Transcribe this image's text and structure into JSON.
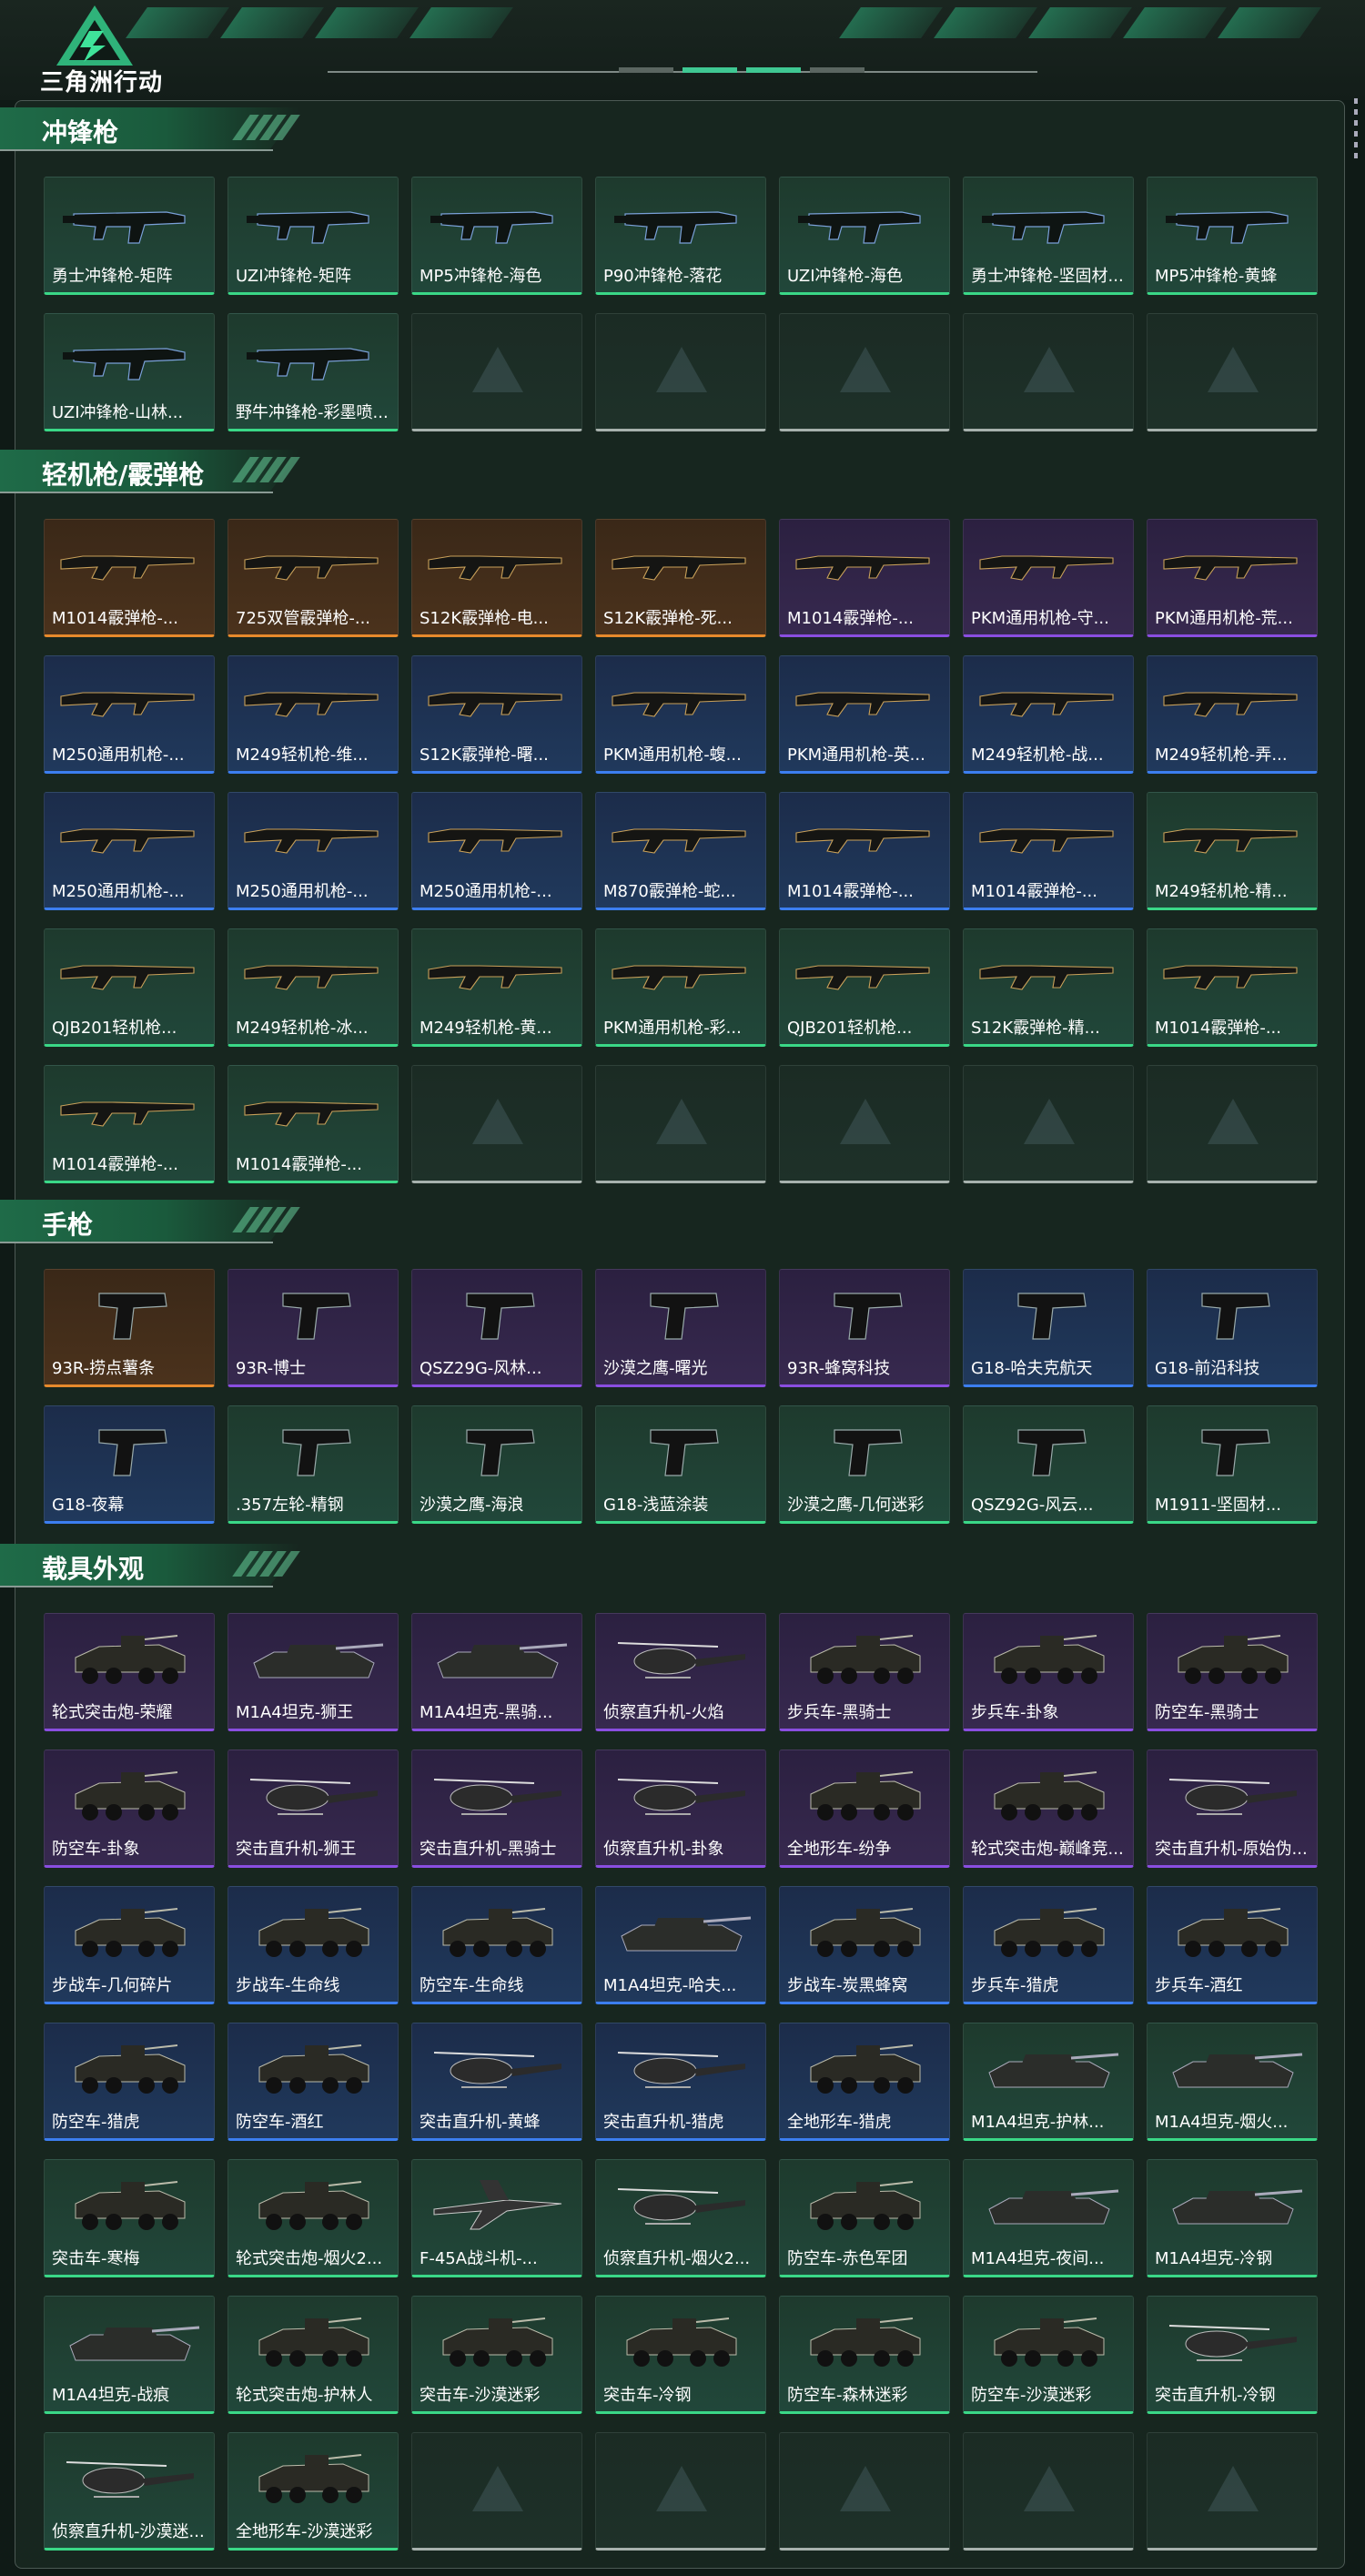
{
  "brand": "三角洲行动",
  "colors": {
    "accent": "#3fc893",
    "q_green": "#3ad887",
    "q_blue": "#3c7ef0",
    "q_purple": "#8a4ee0",
    "q_orange": "#e78a2c"
  },
  "sections": [
    {
      "title": "冲锋枪",
      "items": [
        {
          "name": "勇士冲锋枪-矩阵",
          "q": "green",
          "t": "smg"
        },
        {
          "name": "UZI冲锋枪-矩阵",
          "q": "green",
          "t": "smg"
        },
        {
          "name": "MP5冲锋枪-海色",
          "q": "green",
          "t": "smg"
        },
        {
          "name": "P90冲锋枪-落花",
          "q": "green",
          "t": "smg"
        },
        {
          "name": "UZI冲锋枪-海色",
          "q": "green",
          "t": "smg"
        },
        {
          "name": "勇士冲锋枪-坚固材...",
          "q": "green",
          "t": "smg"
        },
        {
          "name": "MP5冲锋枪-黄蜂",
          "q": "green",
          "t": "smg"
        },
        {
          "name": "UZI冲锋枪-山林...",
          "q": "green",
          "t": "smg"
        },
        {
          "name": "野牛冲锋枪-彩墨喷...",
          "q": "green",
          "t": "smg"
        },
        {
          "name": "",
          "q": "empty"
        },
        {
          "name": "",
          "q": "empty"
        },
        {
          "name": "",
          "q": "empty"
        },
        {
          "name": "",
          "q": "empty"
        },
        {
          "name": "",
          "q": "empty"
        }
      ]
    },
    {
      "title": "轻机枪/霰弹枪",
      "items": [
        {
          "name": "M1014霰弹枪-...",
          "q": "orange",
          "t": "rifle"
        },
        {
          "name": "725双管霰弹枪-...",
          "q": "orange",
          "t": "rifle"
        },
        {
          "name": "S12K霰弹枪-电...",
          "q": "orange",
          "t": "rifle"
        },
        {
          "name": "S12K霰弹枪-死...",
          "q": "orange",
          "t": "rifle"
        },
        {
          "name": "M1014霰弹枪-...",
          "q": "purple",
          "t": "rifle"
        },
        {
          "name": "PKM通用机枪-守...",
          "q": "purple",
          "t": "rifle"
        },
        {
          "name": "PKM通用机枪-荒...",
          "q": "purple",
          "t": "rifle"
        },
        {
          "name": "M250通用机枪-...",
          "q": "blue",
          "t": "rifle"
        },
        {
          "name": "M249轻机枪-维...",
          "q": "blue",
          "t": "rifle"
        },
        {
          "name": "S12K霰弹枪-曙...",
          "q": "blue",
          "t": "rifle"
        },
        {
          "name": "PKM通用机枪-蝮...",
          "q": "blue",
          "t": "rifle"
        },
        {
          "name": "PKM通用机枪-英...",
          "q": "blue",
          "t": "rifle"
        },
        {
          "name": "M249轻机枪-战...",
          "q": "blue",
          "t": "rifle"
        },
        {
          "name": "M249轻机枪-弄...",
          "q": "blue",
          "t": "rifle"
        },
        {
          "name": "M250通用机枪-...",
          "q": "blue",
          "t": "rifle"
        },
        {
          "name": "M250通用机枪-...",
          "q": "blue",
          "t": "rifle"
        },
        {
          "name": "M250通用机枪-...",
          "q": "blue",
          "t": "rifle"
        },
        {
          "name": "M870霰弹枪-蛇...",
          "q": "blue",
          "t": "rifle"
        },
        {
          "name": "M1014霰弹枪-...",
          "q": "blue",
          "t": "rifle"
        },
        {
          "name": "M1014霰弹枪-...",
          "q": "blue",
          "t": "rifle"
        },
        {
          "name": "M249轻机枪-精...",
          "q": "green",
          "t": "rifle"
        },
        {
          "name": "QJB201轻机枪...",
          "q": "green",
          "t": "rifle"
        },
        {
          "name": "M249轻机枪-冰...",
          "q": "green",
          "t": "rifle"
        },
        {
          "name": "M249轻机枪-黄...",
          "q": "green",
          "t": "rifle"
        },
        {
          "name": "PKM通用机枪-彩...",
          "q": "green",
          "t": "rifle"
        },
        {
          "name": "QJB201轻机枪...",
          "q": "green",
          "t": "rifle"
        },
        {
          "name": "S12K霰弹枪-精...",
          "q": "green",
          "t": "rifle"
        },
        {
          "name": "M1014霰弹枪-...",
          "q": "green",
          "t": "rifle"
        },
        {
          "name": "M1014霰弹枪-...",
          "q": "green",
          "t": "rifle"
        },
        {
          "name": "M1014霰弹枪-...",
          "q": "green",
          "t": "rifle"
        },
        {
          "name": "",
          "q": "empty"
        },
        {
          "name": "",
          "q": "empty"
        },
        {
          "name": "",
          "q": "empty"
        },
        {
          "name": "",
          "q": "empty"
        },
        {
          "name": "",
          "q": "empty"
        }
      ]
    },
    {
      "title": "手枪",
      "items": [
        {
          "name": "93R-捞点薯条",
          "q": "orange",
          "t": "pistol"
        },
        {
          "name": "93R-博士",
          "q": "purple",
          "t": "pistol"
        },
        {
          "name": "QSZ29G-风林...",
          "q": "purple",
          "t": "pistol"
        },
        {
          "name": "沙漠之鹰-曙光",
          "q": "purple",
          "t": "pistol"
        },
        {
          "name": "93R-蜂窝科技",
          "q": "purple",
          "t": "pistol"
        },
        {
          "name": "G18-哈夫克航天",
          "q": "blue",
          "t": "pistol"
        },
        {
          "name": "G18-前沿科技",
          "q": "blue",
          "t": "pistol"
        },
        {
          "name": "G18-夜幕",
          "q": "blue",
          "t": "pistol"
        },
        {
          "name": ".357左轮-精钢",
          "q": "green",
          "t": "pistol"
        },
        {
          "name": "沙漠之鹰-海浪",
          "q": "green",
          "t": "pistol"
        },
        {
          "name": "G18-浅蓝涂装",
          "q": "green",
          "t": "pistol"
        },
        {
          "name": "沙漠之鹰-几何迷彩",
          "q": "green",
          "t": "pistol"
        },
        {
          "name": "QSZ92G-风云...",
          "q": "green",
          "t": "pistol"
        },
        {
          "name": "M1911-坚固材...",
          "q": "green",
          "t": "pistol"
        }
      ]
    },
    {
      "title": "载具外观",
      "items": [
        {
          "name": "轮式突击炮-荣耀",
          "q": "purple",
          "t": "vehicle"
        },
        {
          "name": "M1A4坦克-狮王",
          "q": "purple",
          "t": "tank"
        },
        {
          "name": "M1A4坦克-黑骑...",
          "q": "purple",
          "t": "tank"
        },
        {
          "name": "侦察直升机-火焰",
          "q": "purple",
          "t": "heli"
        },
        {
          "name": "步兵车-黑骑士",
          "q": "purple",
          "t": "vehicle"
        },
        {
          "name": "步兵车-卦象",
          "q": "purple",
          "t": "vehicle"
        },
        {
          "name": "防空车-黑骑士",
          "q": "purple",
          "t": "vehicle"
        },
        {
          "name": "防空车-卦象",
          "q": "purple",
          "t": "vehicle"
        },
        {
          "name": "突击直升机-狮王",
          "q": "purple",
          "t": "heli"
        },
        {
          "name": "突击直升机-黑骑士",
          "q": "purple",
          "t": "heli"
        },
        {
          "name": "侦察直升机-卦象",
          "q": "purple",
          "t": "heli"
        },
        {
          "name": "全地形车-纷争",
          "q": "purple",
          "t": "vehicle"
        },
        {
          "name": "轮式突击炮-巅峰竞...",
          "q": "purple",
          "t": "vehicle"
        },
        {
          "name": "突击直升机-原始伪...",
          "q": "purple",
          "t": "heli"
        },
        {
          "name": "步战车-几何碎片",
          "q": "blue",
          "t": "vehicle"
        },
        {
          "name": "步战车-生命线",
          "q": "blue",
          "t": "vehicle"
        },
        {
          "name": "防空车-生命线",
          "q": "blue",
          "t": "vehicle"
        },
        {
          "name": "M1A4坦克-哈夫...",
          "q": "blue",
          "t": "tank"
        },
        {
          "name": "步战车-炭黑蜂窝",
          "q": "blue",
          "t": "vehicle"
        },
        {
          "name": "步兵车-猎虎",
          "q": "blue",
          "t": "vehicle"
        },
        {
          "name": "步兵车-酒红",
          "q": "blue",
          "t": "vehicle"
        },
        {
          "name": "防空车-猎虎",
          "q": "blue",
          "t": "vehicle"
        },
        {
          "name": "防空车-酒红",
          "q": "blue",
          "t": "vehicle"
        },
        {
          "name": "突击直升机-黄蜂",
          "q": "blue",
          "t": "heli"
        },
        {
          "name": "突击直升机-猎虎",
          "q": "blue",
          "t": "heli"
        },
        {
          "name": "全地形车-猎虎",
          "q": "blue",
          "t": "vehicle"
        },
        {
          "name": "M1A4坦克-护林...",
          "q": "green",
          "t": "tank"
        },
        {
          "name": "M1A4坦克-烟火...",
          "q": "green",
          "t": "tank"
        },
        {
          "name": "突击车-寒梅",
          "q": "green",
          "t": "vehicle"
        },
        {
          "name": "轮式突击炮-烟火2...",
          "q": "green",
          "t": "vehicle"
        },
        {
          "name": "F-45A战斗机-...",
          "q": "green",
          "t": "jet"
        },
        {
          "name": "侦察直升机-烟火2...",
          "q": "green",
          "t": "heli"
        },
        {
          "name": "防空车-赤色军团",
          "q": "green",
          "t": "vehicle"
        },
        {
          "name": "M1A4坦克-夜间...",
          "q": "green",
          "t": "tank"
        },
        {
          "name": "M1A4坦克-冷钢",
          "q": "green",
          "t": "tank"
        },
        {
          "name": "M1A4坦克-战痕",
          "q": "green",
          "t": "tank"
        },
        {
          "name": "轮式突击炮-护林人",
          "q": "green",
          "t": "vehicle"
        },
        {
          "name": "突击车-沙漠迷彩",
          "q": "green",
          "t": "vehicle"
        },
        {
          "name": "突击车-冷钢",
          "q": "green",
          "t": "vehicle"
        },
        {
          "name": "防空车-森林迷彩",
          "q": "green",
          "t": "vehicle"
        },
        {
          "name": "防空车-沙漠迷彩",
          "q": "green",
          "t": "vehicle"
        },
        {
          "name": "突击直升机-冷钢",
          "q": "green",
          "t": "heli"
        },
        {
          "name": "侦察直升机-沙漠迷...",
          "q": "green",
          "t": "heli"
        },
        {
          "name": "全地形车-沙漠迷彩",
          "q": "green",
          "t": "vehicle"
        },
        {
          "name": "",
          "q": "empty"
        },
        {
          "name": "",
          "q": "empty"
        },
        {
          "name": "",
          "q": "empty"
        },
        {
          "name": "",
          "q": "empty"
        },
        {
          "name": "",
          "q": "empty"
        }
      ]
    }
  ]
}
